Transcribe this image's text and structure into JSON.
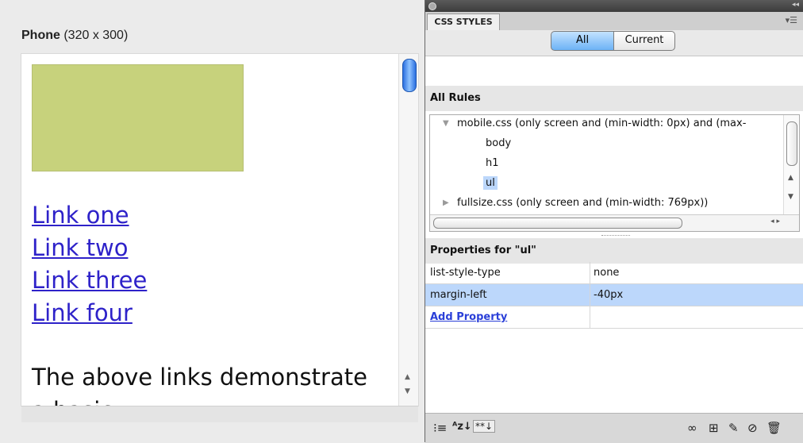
{
  "preview": {
    "title_bold": "Phone",
    "title_size": "(320 x 300)",
    "links": [
      "Link one",
      "Link two",
      "Link three",
      "Link four"
    ],
    "paragraph": "The above links demonstrate a basic",
    "box_color": "#c7d27c",
    "link_color": "#2e22c9"
  },
  "panel": {
    "tab_label": "CSS STYLES",
    "toggle_all": "All",
    "toggle_current": "Current",
    "all_rules_header": "All Rules",
    "rules": [
      {
        "label": "mobile.css (only screen and (min-width: 0px) and (max-",
        "expanded": true
      },
      {
        "label": "body"
      },
      {
        "label": "h1"
      },
      {
        "label": "ul",
        "selected": true
      },
      {
        "label": "fullsize.css (only screen and (min-width: 769px))",
        "expanded": false
      }
    ],
    "properties_header": "Properties for \"ul\"",
    "properties": [
      {
        "name": "list-style-type",
        "value": "none"
      },
      {
        "name": "margin-left",
        "value": "-40px"
      }
    ],
    "add_property": "Add Property",
    "bottom_icons": [
      "category-view-icon",
      "alpha-sort-icon",
      "set-properties-toggle-icon",
      "attach-stylesheet-icon",
      "new-rule-icon",
      "edit-rule-icon",
      "disable-property-icon",
      "delete-icon"
    ],
    "selection_color": "#bcd7fb"
  }
}
